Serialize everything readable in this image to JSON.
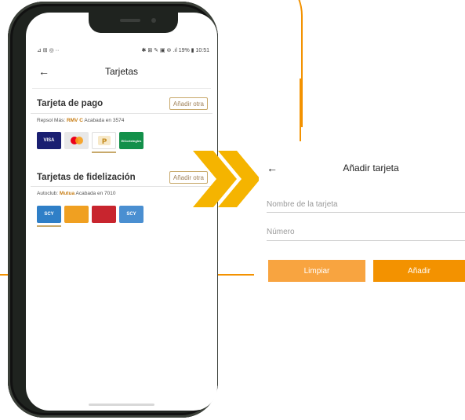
{
  "phone": {
    "status": {
      "left": "⊿ ⊞ ◎ ··",
      "right": "✱ ⊠ ✎ ▣ ⊚ .ıl 19% ▮ 10:51"
    },
    "appbar": {
      "back_icon": "arrow-left-icon",
      "title": "Tarjetas"
    },
    "payment_section": {
      "title": "Tarjeta de pago",
      "add_button": "Añadir otra",
      "subtitle_prefix": "Repsol Más:",
      "subtitle_brand": "RMV C",
      "subtitle_suffix": "Acabada en 3574",
      "cards": [
        {
          "label": "VISA",
          "color": "#1a1f71"
        },
        {
          "label": "●●",
          "color": "#e8e8e8"
        },
        {
          "label": "",
          "color": "#ffffff"
        },
        {
          "label": "ElCorteIngles",
          "color": "#13904a"
        }
      ]
    },
    "loyalty_section": {
      "title": "Tarjetas de fidelización",
      "add_button": "Añadir otra",
      "subtitle_prefix": "Autoclub:",
      "subtitle_brand": "Mutua",
      "subtitle_suffix": "Acabada en 7010",
      "cards": [
        {
          "label": "SCY",
          "color": "#2f7fc7"
        },
        {
          "label": "",
          "color": "#f0a021"
        },
        {
          "label": "",
          "color": "#c8252e"
        },
        {
          "label": "SCY",
          "color": "#4a8fd1"
        }
      ]
    }
  },
  "panel": {
    "back_icon": "arrow-left-icon",
    "title": "Añadir tarjeta",
    "name_placeholder": "Nombre de la tarjeta",
    "number_placeholder": "Número",
    "clear_button": "Limpiar",
    "add_button": "Añadir"
  },
  "colors": {
    "orange": "#f39200",
    "orange_light": "#f8a440",
    "gold": "#c8a96b"
  }
}
